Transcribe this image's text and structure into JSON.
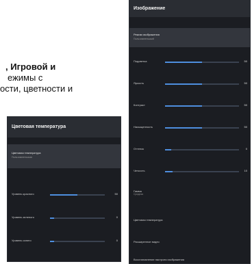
{
  "doc": {
    "line1": ", Игровой и",
    "line2": "ежимы с",
    "line3": "ости, цветности и"
  },
  "right_panel": {
    "title": "Изображение",
    "selected": {
      "label": "Режим изображения",
      "value": "Пользовательский"
    },
    "sliders": [
      {
        "label": "Подсветка",
        "value": 50
      },
      {
        "label": "Яркость",
        "value": 50
      },
      {
        "label": "Контраст",
        "value": 50
      },
      {
        "label": "Насыщенность",
        "value": 50
      },
      {
        "label": "Оттенок",
        "value": 0
      },
      {
        "label": "Четкость",
        "value": 10
      }
    ],
    "gamma": {
      "label": "Гамма",
      "value": "Средняя"
    },
    "menu_items": [
      "Цветовая температура",
      "Расширенное видео",
      "Восстановление настроек изображения"
    ]
  },
  "left_panel": {
    "title": "Цветовая температура",
    "selected": {
      "label": "Цветовая температура",
      "value": "Пользовательская"
    },
    "sliders": [
      {
        "label": "Уровень красного",
        "value": 50
      },
      {
        "label": "Уровень зеленого",
        "value": 0
      },
      {
        "label": "Уровень синего",
        "value": 0
      }
    ]
  },
  "colors": {
    "accent": "#4e8fe0",
    "panel_bg": "#1b1d22",
    "header_bg": "#2a2d33"
  }
}
